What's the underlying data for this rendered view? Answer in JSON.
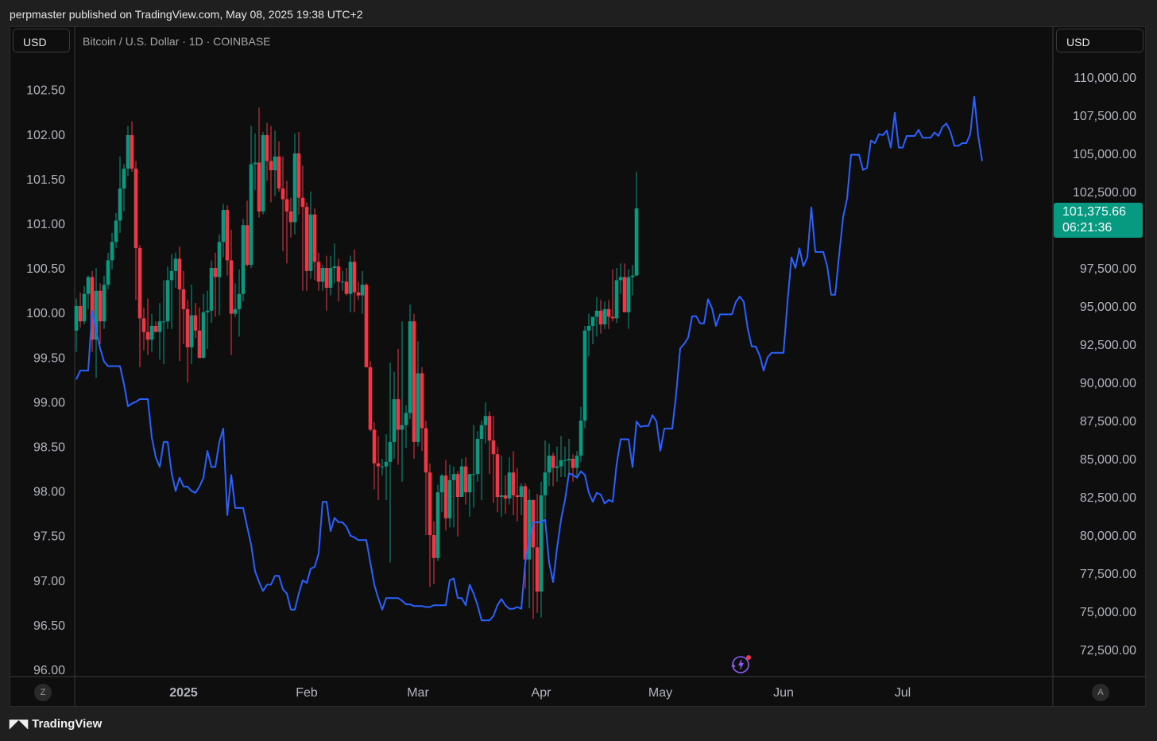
{
  "header": {
    "publisher": "perpmaster published on TradingView.com, May 08, 2025 19:38 UTC+2"
  },
  "left_currency": "USD",
  "right_currency": "USD",
  "symbol": "Bitcoin / U.S. Dollar · 1D · COINBASE",
  "last_price": {
    "value": "101,375.66",
    "countdown": "06:21:36",
    "color": "#089981"
  },
  "footer": {
    "brand": "TradingView",
    "zoom_left": "Z",
    "auto_right": "A"
  },
  "chart_data": {
    "type": "line",
    "left_axis": {
      "ylim": [
        96.0,
        102.7
      ],
      "ticks": [
        "102.50",
        "102.00",
        "101.50",
        "101.00",
        "100.50",
        "100.00",
        "99.50",
        "99.00",
        "98.50",
        "98.00",
        "97.50",
        "97.00",
        "96.50",
        "96.00"
      ]
    },
    "right_axis": {
      "ylim": [
        71000,
        110500
      ],
      "ticks": [
        "110,000.00",
        "107,500.00",
        "105,000.00",
        "102,500.00",
        "97,500.00",
        "95,000.00",
        "92,500.00",
        "90,000.00",
        "87,500.00",
        "85,000.00",
        "82,500.00",
        "80,000.00",
        "77,500.00",
        "75,000.00",
        "72,500.00"
      ]
    },
    "x_ticks": [
      "2025",
      "Feb",
      "Mar",
      "Apr",
      "May",
      "Jun",
      "Jul"
    ],
    "x_tick_days": [
      4,
      35,
      63,
      94,
      124,
      155,
      185
    ],
    "candles": {
      "axis": "right",
      "colors": {
        "up": "#089981",
        "down": "#f23645"
      },
      "start_day": -23,
      "ohlc": [
        [
          93400,
          95500,
          92000,
          95000
        ],
        [
          95000,
          95900,
          93600,
          94000
        ],
        [
          94000,
          96300,
          93800,
          95800
        ],
        [
          95800,
          97000,
          94800,
          96900
        ],
        [
          96900,
          97300,
          92000,
          92800
        ],
        [
          92800,
          97500,
          90300,
          96000
        ],
        [
          96000,
          96500,
          92500,
          94000
        ],
        [
          94000,
          97000,
          93500,
          96400
        ],
        [
          96400,
          98500,
          96100,
          98000
        ],
        [
          98000,
          99800,
          97400,
          99200
        ],
        [
          99200,
          101100,
          98800,
          100600
        ],
        [
          100600,
          104800,
          99800,
          102700
        ],
        [
          102700,
          104300,
          101200,
          104000
        ],
        [
          104000,
          106800,
          103500,
          106200
        ],
        [
          106200,
          107100,
          103800,
          104000
        ],
        [
          104000,
          104500,
          95400,
          98800
        ],
        [
          98800,
          99000,
          91000,
          94200
        ],
        [
          94200,
          94900,
          92100,
          93300
        ],
        [
          93300,
          95500,
          91800,
          92800
        ],
        [
          92800,
          94500,
          92000,
          93700
        ],
        [
          93700,
          94000,
          93300,
          93300
        ],
        [
          93300,
          95200,
          91500,
          94000
        ],
        [
          94000,
          96700,
          91200,
          94000
        ],
        [
          94000,
          97600,
          93500,
          96700
        ],
        [
          96700,
          98400,
          93500,
          97300
        ],
        [
          97300,
          98500,
          96200,
          98100
        ],
        [
          98100,
          98900,
          91400,
          96100
        ],
        [
          96100,
          97300,
          92500,
          94800
        ],
        [
          94800,
          95400,
          90000,
          92300
        ],
        [
          92300,
          96400,
          91200,
          94400
        ],
        [
          94400,
          95200,
          92900,
          93400
        ],
        [
          93400,
          94900,
          91600,
          91600
        ],
        [
          91600,
          95800,
          91600,
          94600
        ],
        [
          94600,
          96000,
          92200,
          94700
        ],
        [
          94700,
          98000,
          93900,
          97500
        ],
        [
          97500,
          98500,
          94300,
          96900
        ],
        [
          96900,
          99700,
          94400,
          99200
        ],
        [
          99200,
          101700,
          98200,
          101300
        ],
        [
          101300,
          101600,
          97000,
          98000
        ],
        [
          98000,
          100000,
          91800,
          94500
        ],
        [
          94500,
          96500,
          94300,
          94800
        ],
        [
          94800,
          97400,
          93000,
          95800
        ],
        [
          95800,
          100700,
          95300,
          100300
        ],
        [
          100300,
          101900,
          97600,
          97700
        ],
        [
          97700,
          106800,
          97500,
          104300
        ],
        [
          104300,
          106300,
          102600,
          104400
        ],
        [
          104400,
          108000,
          100800,
          101200
        ],
        [
          101200,
          106400,
          101000,
          106200
        ],
        [
          106200,
          107000,
          103200,
          104500
        ],
        [
          104500,
          106800,
          101800,
          103900
        ],
        [
          103900,
          106500,
          102200,
          104800
        ],
        [
          104800,
          105800,
          102500,
          102700
        ],
        [
          102700,
          104800,
          98600,
          102000
        ],
        [
          102000,
          103200,
          97800,
          101200
        ],
        [
          101200,
          102100,
          99500,
          100500
        ],
        [
          100500,
          106300,
          99700,
          105000
        ],
        [
          105000,
          106400,
          101000,
          102100
        ],
        [
          102100,
          104200,
          96000,
          101500
        ],
        [
          101500,
          101800,
          96000,
          97300
        ],
        [
          97300,
          102500,
          96800,
          101000
        ],
        [
          101000,
          101400,
          96700,
          97900
        ],
        [
          97900,
          98500,
          96000,
          96600
        ],
        [
          96600,
          97700,
          96000,
          97500
        ],
        [
          97500,
          98300,
          94700,
          96200
        ],
        [
          96200,
          98300,
          95700,
          97500
        ],
        [
          97500,
          99100,
          96500,
          97600
        ],
        [
          97600,
          98100,
          95300,
          96600
        ],
        [
          96600,
          97300,
          96000,
          96600
        ],
        [
          96600,
          97500,
          95700,
          95800
        ],
        [
          95800,
          98300,
          94600,
          97900
        ],
        [
          97900,
          98700,
          94600,
          95900
        ],
        [
          95900,
          96600,
          95400,
          95700
        ],
        [
          95700,
          97300,
          94500,
          96400
        ],
        [
          96400,
          96500,
          91200,
          91000
        ],
        [
          91000,
          91400,
          86800,
          86900
        ],
        [
          86900,
          87400,
          83000,
          84700
        ],
        [
          84700,
          86500,
          82300,
          84500
        ],
        [
          84500,
          85000,
          83900,
          84500
        ],
        [
          84500,
          86600,
          82300,
          84800
        ],
        [
          84800,
          91300,
          78200,
          86100
        ],
        [
          86100,
          90700,
          85000,
          88900
        ],
        [
          88900,
          92200,
          84600,
          86900
        ],
        [
          86900,
          94000,
          83500,
          87200
        ],
        [
          87200,
          88500,
          85700,
          88000
        ],
        [
          88000,
          95100,
          87600,
          94000
        ],
        [
          94000,
          94500,
          85000,
          86100
        ],
        [
          86100,
          92700,
          85800,
          90600
        ],
        [
          90600,
          91000,
          85500,
          87000
        ],
        [
          87000,
          87500,
          80000,
          84100
        ],
        [
          84100,
          84700,
          76600,
          80000
        ],
        [
          80000,
          80900,
          76800,
          78500
        ],
        [
          78500,
          83300,
          78300,
          82800
        ],
        [
          82800,
          84000,
          81500,
          83900
        ],
        [
          83900,
          84900,
          80300,
          81100
        ],
        [
          81100,
          84600,
          80500,
          83600
        ],
        [
          83600,
          84500,
          80500,
          84000
        ],
        [
          84000,
          84200,
          79900,
          82500
        ],
        [
          82500,
          85000,
          82500,
          84500
        ],
        [
          84500,
          85100,
          82000,
          82800
        ],
        [
          82800,
          83700,
          81200,
          84000
        ],
        [
          84000,
          87200,
          81800,
          84000
        ],
        [
          84000,
          86800,
          83500,
          86300
        ],
        [
          86300,
          87500,
          82300,
          87200
        ],
        [
          87200,
          88700,
          86000,
          87800
        ],
        [
          87800,
          88100,
          84000,
          86200
        ],
        [
          86200,
          87800,
          82100,
          85300
        ],
        [
          85300,
          85800,
          81500,
          82500
        ],
        [
          82500,
          85200,
          81200,
          82600
        ],
        [
          82600,
          83900,
          81400,
          82400
        ],
        [
          82400,
          85100,
          82000,
          84100
        ],
        [
          84100,
          85500,
          81300,
          82600
        ],
        [
          82600,
          84400,
          80900,
          82500
        ],
        [
          82500,
          83400,
          81300,
          83200
        ],
        [
          83200,
          83400,
          76500,
          78400
        ],
        [
          78400,
          83000,
          75200,
          82300
        ],
        [
          82300,
          82300,
          74500,
          79200
        ],
        [
          79200,
          82700,
          74900,
          76300
        ],
        [
          76300,
          83500,
          74600,
          82600
        ],
        [
          82600,
          86200,
          81100,
          84100
        ],
        [
          84100,
          86000,
          83200,
          85200
        ],
        [
          85200,
          85400,
          83200,
          84400
        ],
        [
          84400,
          85800,
          83500,
          84500
        ],
        [
          84500,
          86500,
          83800,
          84900
        ],
        [
          84900,
          85800,
          83800,
          84900
        ],
        [
          84900,
          86300,
          84000,
          85000
        ],
        [
          85000,
          85300,
          83500,
          84400
        ],
        [
          84400,
          85500,
          83800,
          85200
        ],
        [
          85200,
          88400,
          84800,
          87500
        ],
        [
          87500,
          93700,
          87000,
          93400
        ],
        [
          93400,
          94500,
          91700,
          93700
        ],
        [
          93700,
          94000,
          92500,
          94300
        ],
        [
          94300,
          95600,
          93000,
          94700
        ],
        [
          94700,
          95400,
          93200,
          93800
        ],
        [
          93800,
          95300,
          93500,
          94800
        ],
        [
          94800,
          95400,
          93500,
          94300
        ],
        [
          94300,
          97400,
          94000,
          94200
        ],
        [
          94200,
          97500,
          93900,
          96700
        ],
        [
          96700,
          97800,
          95800,
          96900
        ],
        [
          96900,
          97800,
          95200,
          94600
        ],
        [
          94600,
          97400,
          93500,
          96900
        ],
        [
          96900,
          97700,
          95700,
          97000
        ],
        [
          97000,
          103800,
          97000,
          101400
        ]
      ]
    },
    "series": [
      {
        "name": "",
        "axis": "left",
        "color": "#2962ff",
        "start_day": -23,
        "values": [
          99.25,
          99.35,
          99.35,
          99.35,
          100.02,
          99.8,
          99.6,
          99.45,
          99.4,
          99.4,
          99.4,
          99.4,
          99.2,
          98.95,
          98.98,
          99.0,
          99.03,
          99.03,
          99.03,
          98.6,
          98.38,
          98.27,
          98.55,
          98.55,
          98.2,
          98.0,
          98.15,
          98.05,
          98.05,
          98.0,
          97.98,
          98.05,
          98.15,
          98.45,
          98.27,
          98.27,
          98.55,
          98.7,
          97.73,
          98.18,
          97.81,
          97.81,
          97.81,
          97.6,
          97.4,
          97.1,
          96.98,
          96.88,
          96.95,
          96.95,
          97.05,
          97.05,
          96.9,
          96.85,
          96.67,
          96.67,
          96.85,
          97.0,
          96.97,
          97.13,
          97.15,
          97.3,
          97.88,
          97.88,
          97.55,
          97.7,
          97.65,
          97.65,
          97.6,
          97.5,
          97.48,
          97.45,
          97.45,
          97.45,
          97.2,
          96.95,
          96.8,
          96.67,
          96.8,
          96.8,
          96.8,
          96.8,
          96.77,
          96.73,
          96.73,
          96.71,
          96.71,
          96.71,
          96.7,
          96.7,
          96.72,
          96.72,
          96.72,
          96.72,
          97.0,
          97.02,
          96.8,
          96.8,
          96.72,
          96.95,
          96.85,
          96.72,
          96.55,
          96.55,
          96.55,
          96.6,
          96.72,
          96.79,
          96.72,
          96.68,
          96.68,
          96.7,
          96.68,
          97.2,
          97.45,
          97.65,
          97.65,
          97.65,
          97.68,
          97.2,
          96.98,
          97.36,
          97.68,
          97.9,
          98.2,
          98.18,
          98.15,
          98.22,
          98.18,
          97.98,
          97.88,
          97.98,
          97.96,
          97.86,
          97.9,
          97.88,
          98.3,
          98.58,
          98.58,
          98.58,
          98.27,
          98.78,
          98.72,
          98.73,
          98.73,
          98.85,
          98.78,
          98.45,
          98.7,
          98.7,
          98.7,
          99.1,
          99.6,
          99.65,
          99.72,
          99.96,
          99.96,
          99.88,
          99.88,
          100.15,
          100.05,
          99.85,
          99.98,
          99.98,
          99.98,
          99.98,
          100.12,
          100.18,
          100.12,
          99.82,
          99.62,
          99.62,
          99.52,
          99.35,
          99.5,
          99.55,
          99.55,
          99.55,
          99.55,
          100.12,
          100.62,
          100.5,
          100.72,
          100.52,
          100.62,
          101.18,
          100.68,
          100.68,
          100.68,
          100.52,
          100.2,
          100.2,
          100.65,
          101.07,
          101.28,
          101.77,
          101.77,
          101.77,
          101.6,
          101.62,
          101.93,
          101.9,
          102.0,
          101.99,
          102.04,
          101.85,
          102.24,
          101.85,
          101.85,
          101.98,
          101.98,
          101.98,
          102.05,
          101.96,
          101.96,
          101.96,
          102.02,
          101.98,
          102.08,
          102.12,
          102.03,
          101.87,
          101.87,
          101.9,
          101.9,
          102.0,
          102.42,
          101.98,
          101.7
        ]
      }
    ]
  }
}
